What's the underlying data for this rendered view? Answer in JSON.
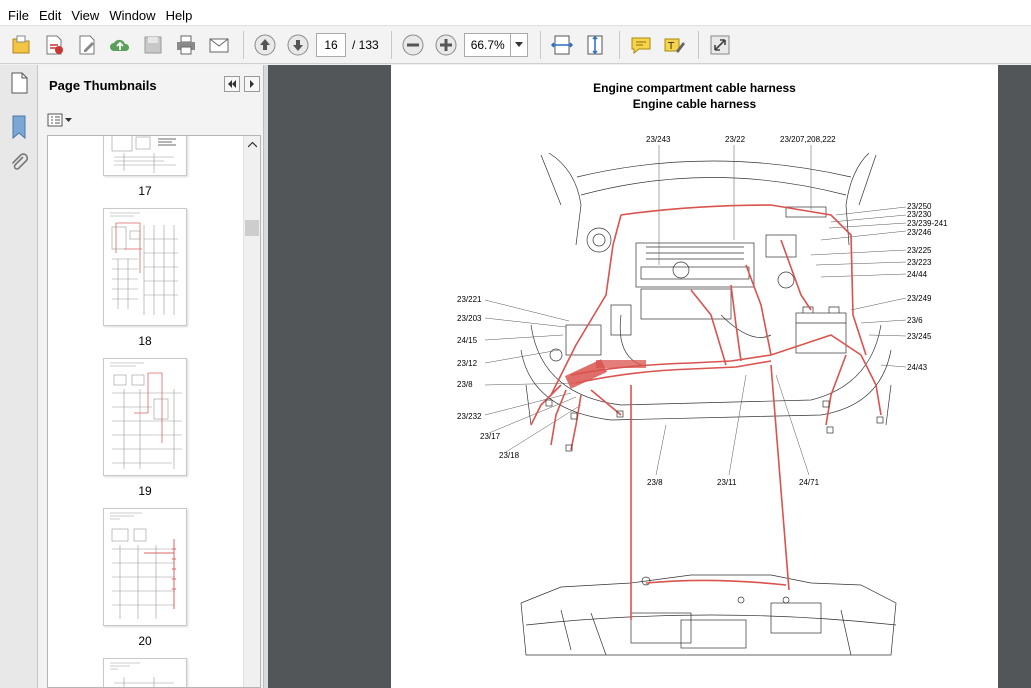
{
  "menu": [
    "File",
    "Edit",
    "View",
    "Window",
    "Help"
  ],
  "toolbar": {
    "current_page": "16",
    "page_total": "/ 133",
    "zoom": "66.7%"
  },
  "sidebar": {
    "title": "Page Thumbnails",
    "thumbnails": [
      {
        "label": "17"
      },
      {
        "label": "18"
      },
      {
        "label": "19"
      },
      {
        "label": "20"
      }
    ]
  },
  "document": {
    "title_line1": "Engine compartment cable harness",
    "title_line2": "Engine cable harness",
    "callouts": {
      "c1": "23/243",
      "c2": "23/22",
      "c3": "23/207,208,222",
      "c4": "23/250",
      "c5": "23/230",
      "c6": "23/239-241",
      "c7": "23/246",
      "c8": "23/225",
      "c9": "23/223",
      "c10": "24/44",
      "c11": "23/249",
      "c12": "23/6",
      "c13": "23/245",
      "c14": "24/43",
      "c15": "23/221",
      "c16": "23/203",
      "c17": "24/15",
      "c18": "23/12",
      "c19": "23/8",
      "c20": "23/232",
      "c21": "23/17",
      "c22": "23/18",
      "c23": "23/8",
      "c24": "23/11",
      "c25": "24/71"
    }
  },
  "colors": {
    "doc_background": "#525659",
    "harness_red": "#d9534f"
  }
}
